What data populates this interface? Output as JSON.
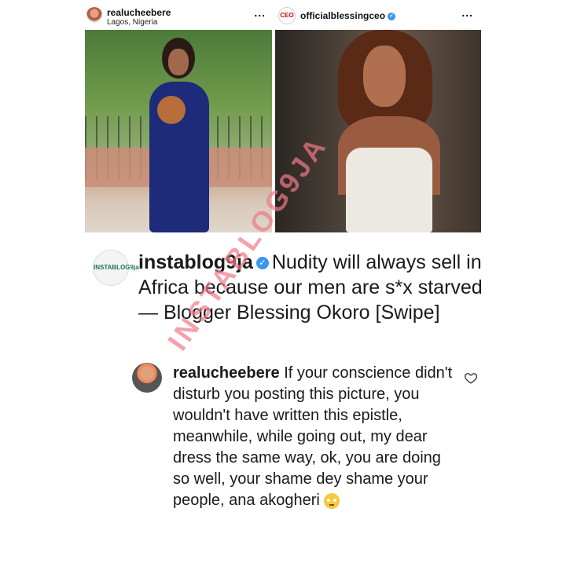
{
  "left_post": {
    "username": "realucheebere",
    "location": "Lagos, Nigeria",
    "more_label": "..."
  },
  "right_post": {
    "avatar_label": "CEO",
    "username": "officialblessingceo",
    "more_label": "..."
  },
  "caption": {
    "avatar_label": "INSTABLOG9ja",
    "username": "instablog9ja",
    "text": "Nudity will always sell in Africa because our men are s*x starved — Blogger Blessing Okoro [Swipe]"
  },
  "watermark": "INSTABLOG9JA",
  "comment": {
    "username": "realucheebere",
    "text": "If your conscience didn't disturb you posting this picture, you wouldn't have written this epistle, meanwhile, while going out, my dear dress the same way, ok, you are doing so well, your shame dey shame your people, ana akogheri"
  },
  "icons": {
    "verified": "verified-badge-icon",
    "like": "heart-icon",
    "emoji": "rolling-eyes-emoji-icon"
  },
  "colors": {
    "verified": "#3897f0",
    "watermark": "#f07a8a"
  }
}
